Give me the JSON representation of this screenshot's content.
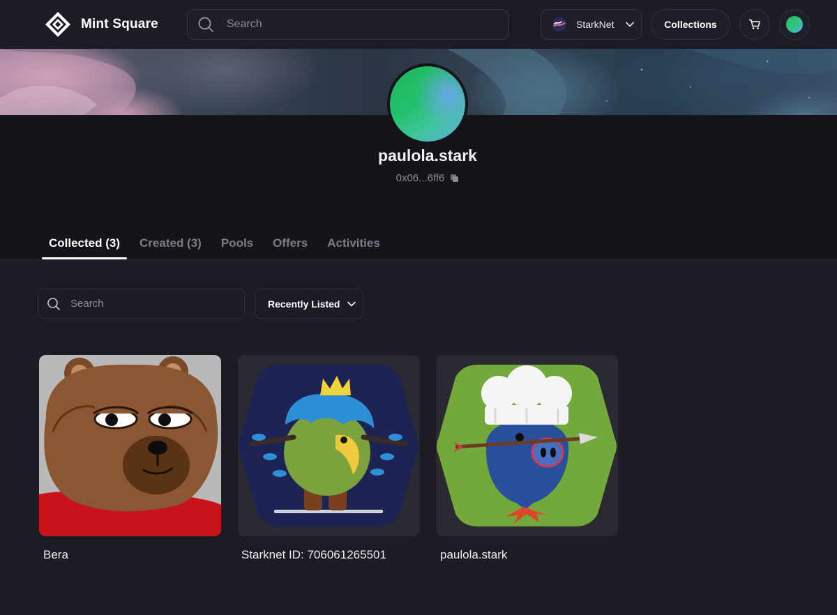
{
  "header": {
    "brand_name": "Mint Square",
    "search_placeholder": "Search",
    "network_label": "StarkNet",
    "collections_label": "Collections"
  },
  "profile": {
    "name": "paulola.stark",
    "address": "0x06...6ff6"
  },
  "tabs": [
    {
      "label": "Collected (3)",
      "active": true
    },
    {
      "label": "Created (3)",
      "active": false
    },
    {
      "label": "Pools",
      "active": false
    },
    {
      "label": "Offers",
      "active": false
    },
    {
      "label": "Activities",
      "active": false
    }
  ],
  "filters": {
    "search_placeholder": "Search",
    "sort_label": "Recently Listed"
  },
  "items": [
    {
      "title": "Bera",
      "image": "bear-pfp"
    },
    {
      "title": "Starknet ID: 706061265501",
      "image": "crowned-bird-hexagon"
    },
    {
      "title": "paulola.stark",
      "image": "chef-pig-hexagon"
    }
  ],
  "colors": {
    "background": "#1c1c24",
    "profile_band": "#141419",
    "card_background": "#2a2a33",
    "tab_inactive": "#7d7d88",
    "text": "#ffffff"
  },
  "icons": [
    "mint-square-logo-icon",
    "search-icon",
    "starknet-icon",
    "chevron-down-icon",
    "cart-icon",
    "copy-icon"
  ]
}
